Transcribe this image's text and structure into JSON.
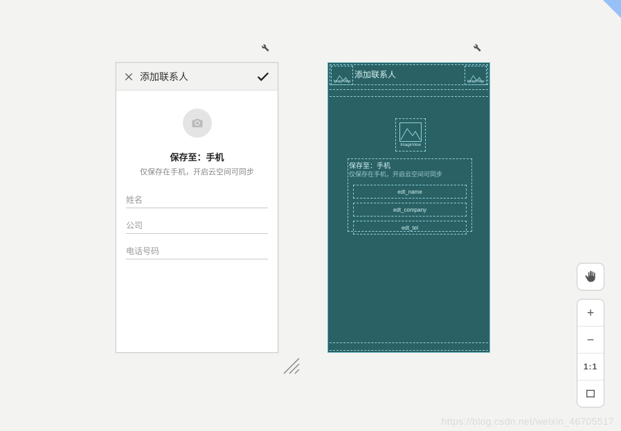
{
  "left_render": {
    "header": {
      "title": "添加联系人"
    },
    "save_line": "保存至：手机",
    "save_sub": "仅保存在手机，开启云空间可同步",
    "fields": {
      "name_placeholder": "姓名",
      "company_placeholder": "公司",
      "tel_placeholder": "电话号码"
    }
  },
  "right_blueprint": {
    "title": "添加联系人",
    "image_label": "ImageView",
    "save_line": "保存至：手机",
    "save_sub": "仅保存在手机，开启云空间可同步",
    "fields": {
      "f1": "edt_name",
      "f2": "edt_company",
      "f3": "edt_tel"
    }
  },
  "toolbar": {
    "zoom_in": "+",
    "zoom_out": "−",
    "one_to_one": "1:1"
  },
  "watermark": "https://blog.csdn.net/weixin_46705517"
}
